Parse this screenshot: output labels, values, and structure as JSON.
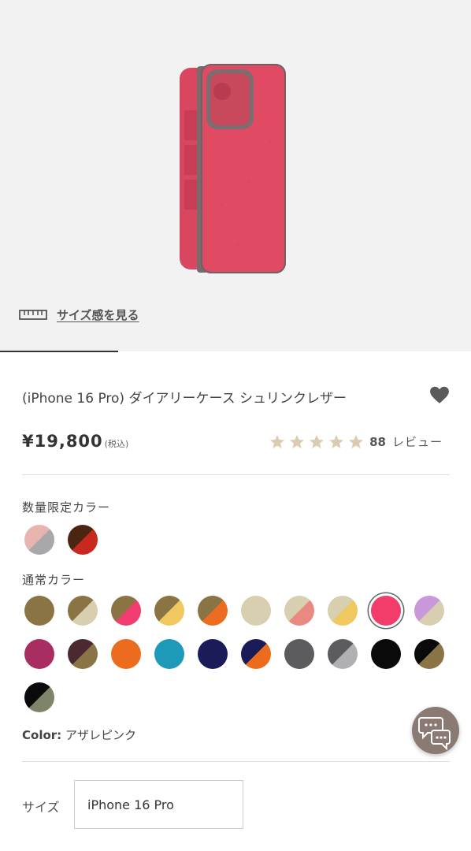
{
  "hero": {
    "size_link_label": "サイズ感を見る"
  },
  "product": {
    "title": "(iPhone 16 Pro) ダイアリーケース シュリンクレザー",
    "price": "¥19,800",
    "tax_note": "(税込)",
    "rating_stars": 5,
    "review_count": "88",
    "review_label": "レビュー"
  },
  "limited_colors": {
    "label": "数量限定カラー",
    "swatches": [
      {
        "name": "limited-pink-gray",
        "top": "#e8b4b0",
        "bottom": "#a8a8aa"
      },
      {
        "name": "limited-brown-red",
        "top": "#4a2612",
        "bottom": "#c8281e"
      }
    ]
  },
  "regular_colors": {
    "label": "通常カラー",
    "swatches": [
      {
        "name": "olive",
        "top": "#8a7444",
        "bottom": "#8a7444"
      },
      {
        "name": "olive-beige",
        "top": "#8a7444",
        "bottom": "#d8ceb0"
      },
      {
        "name": "olive-pink",
        "top": "#8a7444",
        "bottom": "#f03c6e"
      },
      {
        "name": "olive-yellow",
        "top": "#8a7444",
        "bottom": "#f0c860"
      },
      {
        "name": "olive-orange",
        "top": "#8a7444",
        "bottom": "#ec6c22"
      },
      {
        "name": "beige",
        "top": "#d8ceb0",
        "bottom": "#d8ceb0"
      },
      {
        "name": "beige-coral",
        "top": "#d8ceb0",
        "bottom": "#e88a82"
      },
      {
        "name": "beige-yellow",
        "top": "#d8ceb0",
        "bottom": "#f0c860"
      },
      {
        "name": "azalea-pink",
        "top": "#f23c6a",
        "bottom": "#f23c6a",
        "selected": true
      },
      {
        "name": "lavender-beige",
        "top": "#c898d8",
        "bottom": "#d8ceb0"
      },
      {
        "name": "magenta",
        "top": "#a82e62",
        "bottom": "#a82e62"
      },
      {
        "name": "plum-olive",
        "top": "#4a2a30",
        "bottom": "#8a7444"
      },
      {
        "name": "orange",
        "top": "#ec6c1e",
        "bottom": "#ec6c1e"
      },
      {
        "name": "teal",
        "top": "#1e9ab8",
        "bottom": "#1e9ab8"
      },
      {
        "name": "navy",
        "top": "#1a1c5a",
        "bottom": "#1a1c5a"
      },
      {
        "name": "navy-orange",
        "top": "#1a1c5a",
        "bottom": "#ec6c1e"
      },
      {
        "name": "gray",
        "top": "#5c5c5e",
        "bottom": "#5c5c5e"
      },
      {
        "name": "gray-silver",
        "top": "#5c5c5e",
        "bottom": "#b0b0b2"
      },
      {
        "name": "black",
        "top": "#0a0a0a",
        "bottom": "#0a0a0a"
      },
      {
        "name": "black-olive",
        "top": "#0a0a0a",
        "bottom": "#8a7444"
      },
      {
        "name": "black-sage",
        "top": "#0a0a0a",
        "bottom": "#7e8468"
      }
    ]
  },
  "selected_color": {
    "key": "Color:",
    "value": "アザレピンク"
  },
  "size": {
    "label": "サイズ",
    "value": "iPhone 16 Pro"
  },
  "colors": {
    "accent_star": "#d9ccb2",
    "heart": "#5a5a5a",
    "case_pink": "#e04a62"
  }
}
